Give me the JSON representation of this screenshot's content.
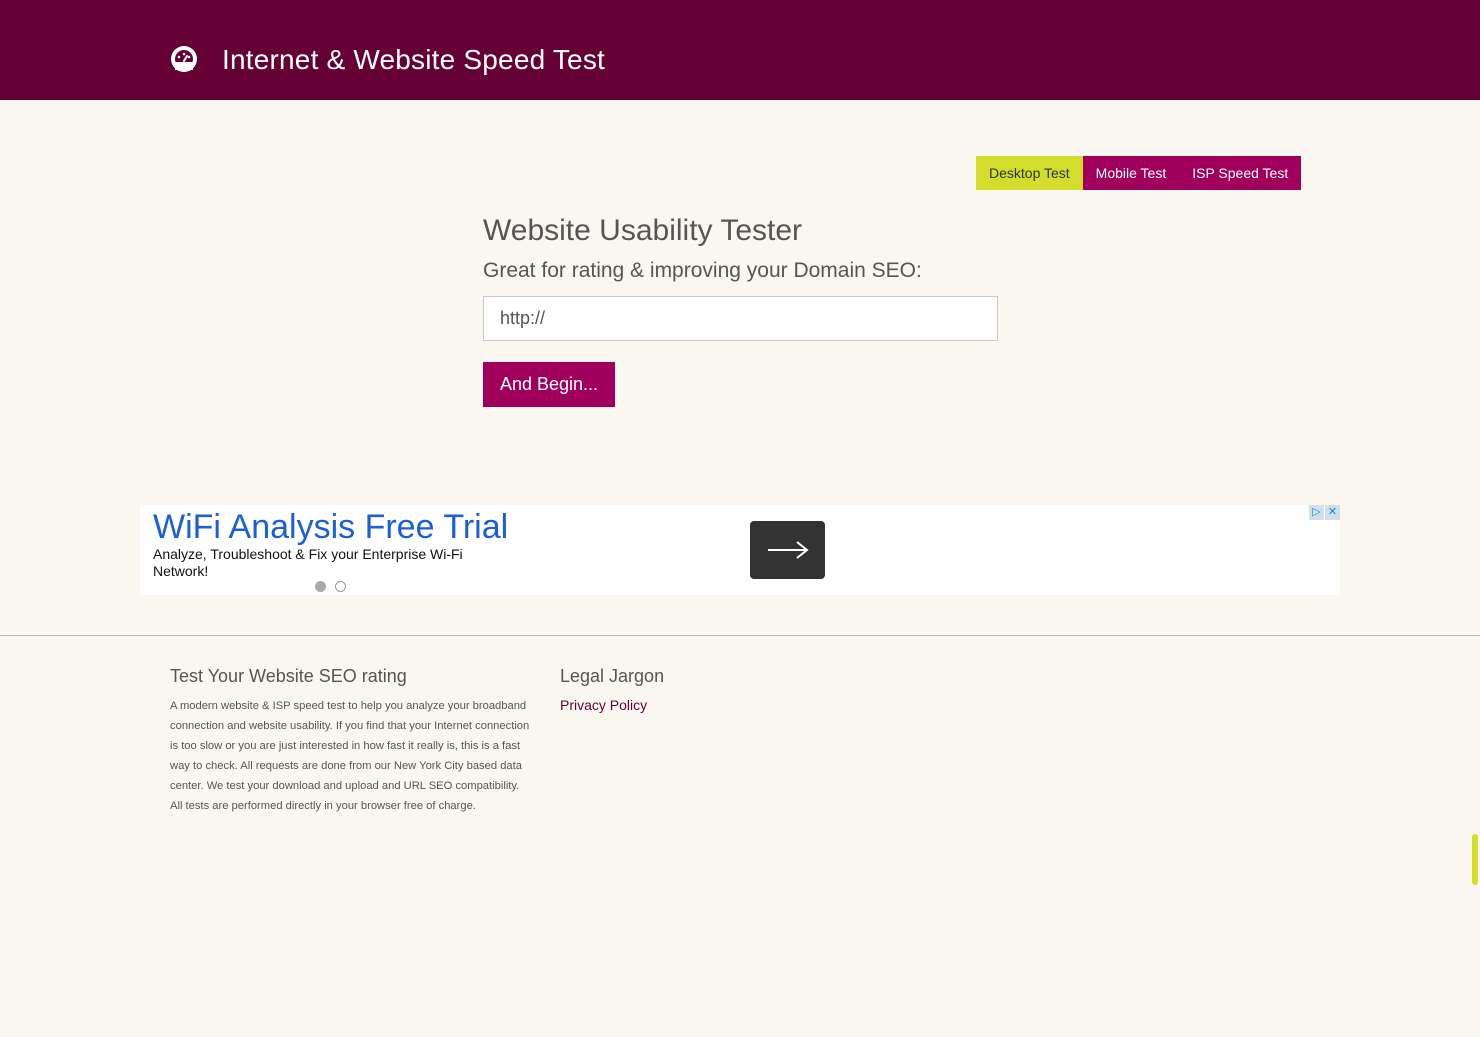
{
  "header": {
    "title": "Internet & Website Speed Test",
    "logo_icon": "speedometer-icon"
  },
  "tabs": [
    {
      "label": "Desktop Test",
      "active": true
    },
    {
      "label": "Mobile Test",
      "active": false
    },
    {
      "label": "ISP Speed Test",
      "active": false
    }
  ],
  "main": {
    "title": "Website Usability Tester",
    "subtitle": "Great for rating & improving your Domain SEO:",
    "url_value": "http://",
    "begin_label": "And Begin..."
  },
  "ad": {
    "headline": "WiFi Analysis Free Trial",
    "body": "Analyze, Troubleshoot & Fix your Enterprise Wi-Fi Network!",
    "choices_icon": "ad-choices-icon",
    "close_icon": "close-icon",
    "arrow_icon": "arrow-right-icon"
  },
  "footer": {
    "about_title": "Test Your Website SEO rating",
    "about_text": "A modern website & ISP speed test to help you analyze your broadband connection and website usability. If you find that your Internet connection is too slow or you are just interested in how fast it really is, this is a fast way to check. All requests are done from our New York City based data center. We test your download and upload and URL SEO compatibility. All tests are performed directly in your browser free of charge.",
    "legal_title": "Legal Jargon",
    "privacy_label": "Privacy Policy"
  },
  "colors": {
    "header_bg": "#650035",
    "accent": "#a0005b",
    "active_tab": "#d4dc2c",
    "page_bg": "#f9f7ef"
  }
}
